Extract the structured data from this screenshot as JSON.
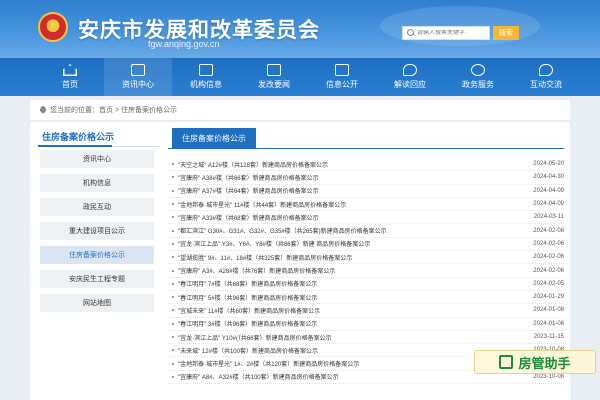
{
  "header": {
    "title": "安庆市发展和改革委员会",
    "url": "fgw.anqing.gov.cn",
    "search_placeholder": "请输入搜索关键字",
    "search_button": "搜索"
  },
  "nav": [
    {
      "label": "首页",
      "icon": "home-icon"
    },
    {
      "label": "资讯中心",
      "icon": "newspaper-icon"
    },
    {
      "label": "机构信息",
      "icon": "building-icon"
    },
    {
      "label": "发改要闻",
      "icon": "news-icon"
    },
    {
      "label": "信息公开",
      "icon": "document-icon"
    },
    {
      "label": "解读回应",
      "icon": "reply-icon"
    },
    {
      "label": "政务服务",
      "icon": "service-icon"
    },
    {
      "label": "互动交流",
      "icon": "chat-icon"
    }
  ],
  "breadcrumb": {
    "prefix": "您当前的位置：",
    "path": "首页 > 住房备案价格公示"
  },
  "sidebar": {
    "title": "住房备案价格公示",
    "items": [
      {
        "label": "资讯中心"
      },
      {
        "label": "机构信息"
      },
      {
        "label": "政民互动"
      },
      {
        "label": "重大建设项目公示"
      },
      {
        "label": "住房备案价格公示"
      },
      {
        "label": "安庆民生工程专题"
      },
      {
        "label": "网站地图"
      }
    ]
  },
  "content": {
    "tab": "住房备案价格公示",
    "items": [
      {
        "title": "\"天空之城\" A12#楼（共128套）新建商品房价格备案公示",
        "date": "2024-05-20"
      },
      {
        "title": "\"宜康府\" A38#楼（共66套）新建商品房价格备案公示",
        "date": "2024-04-30"
      },
      {
        "title": "\"宜康府\" A37#楼（共64套）新建商品房价格备案公示",
        "date": "2024-04-09"
      },
      {
        "title": "\"金地邦泰·城市星光\" 11#楼（共44套）新建商品房价格备案公示",
        "date": "2024-04-09"
      },
      {
        "title": "\"宜康府\" A33#楼（共68套）新建商品房价格备案公示",
        "date": "2024-03-11"
      },
      {
        "title": "\"都汇滨江\" G30#、G31#、G32#、G35#楼（共265套)新建商品房价格备案公示",
        "date": "2024-02-08"
      },
      {
        "title": "\"宜龙·滨江上品\" Y3#、Y6#、Y8#楼（共66套）新建 商品房价格备案公示",
        "date": "2024-02-06"
      },
      {
        "title": "\"望湖揽胜\" 9#、11#、18#楼（共325套）新建商品房价格备案公示",
        "date": "2024-02-06"
      },
      {
        "title": "\"宜康府\" A3#、A28#楼（共76套）新建商品房价格备案公示",
        "date": "2024-02-06"
      },
      {
        "title": "\"春江明月\" 7#楼（共68套）新建商品房价格备案公示",
        "date": "2024-02-05"
      },
      {
        "title": "\"春江明月\" 5#楼（共96套）新建商品房价格备案公示",
        "date": "2024-01-29"
      },
      {
        "title": "\"宜城未来\" 11#楼（共60套）新建商品房价格备案公示",
        "date": "2024-01-08"
      },
      {
        "title": "\"春江明月\" 3#楼（共96套）新建商品房价格备案公示",
        "date": "2024-01-08"
      },
      {
        "title": "\"宜龙·滨江上品\" Y10#(（共66套）新建商品房价格备案公示",
        "date": "2023-11-15"
      },
      {
        "title": "\"未来城\" 12#楼（共100套）新建商品房价格备案公示",
        "date": "2023-10-08"
      },
      {
        "title": "\"金地邦泰·城市星光\" 1#、2#楼（共120套）新建商品房价格备案公示",
        "date": "2023-10-08"
      },
      {
        "title": "\"宜康府\" A8#、A32#楼（共100套）新建商品房价格备案公示",
        "date": "2023-10-08"
      }
    ]
  },
  "watermark": "房管助手"
}
